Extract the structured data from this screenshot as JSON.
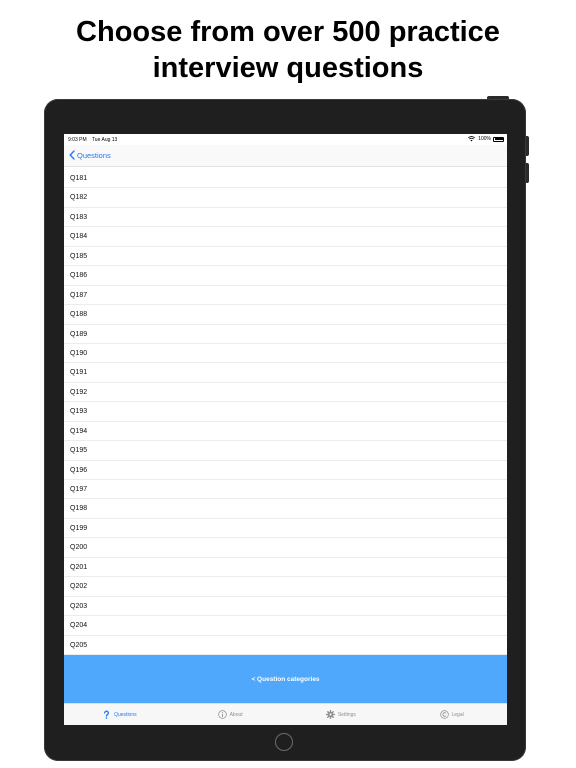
{
  "headline": {
    "line1": "Choose from over 500 practice",
    "line2": "interview questions"
  },
  "status_bar": {
    "time": "9:03 PM",
    "date": "Tue Aug 13",
    "battery": "100%"
  },
  "nav_bar": {
    "back_label": "Questions"
  },
  "questions": [
    "Q181",
    "Q182",
    "Q183",
    "Q184",
    "Q185",
    "Q186",
    "Q187",
    "Q188",
    "Q189",
    "Q190",
    "Q191",
    "Q192",
    "Q193",
    "Q194",
    "Q195",
    "Q196",
    "Q197",
    "Q198",
    "Q199",
    "Q200",
    "Q201",
    "Q202",
    "Q203",
    "Q204",
    "Q205"
  ],
  "categories_button": {
    "label": "< Question categories"
  },
  "tabs": [
    {
      "label": "Questions",
      "icon": "question-mark-icon",
      "active": true
    },
    {
      "label": "About",
      "icon": "info-icon",
      "active": false
    },
    {
      "label": "Settings",
      "icon": "gear-icon",
      "active": false
    },
    {
      "label": "Legal",
      "icon": "copyright-icon",
      "active": false
    }
  ],
  "colors": {
    "accent": "#1f7bf6",
    "bar_blue": "#4fa8fb",
    "tab_inactive": "#8e8e93"
  }
}
